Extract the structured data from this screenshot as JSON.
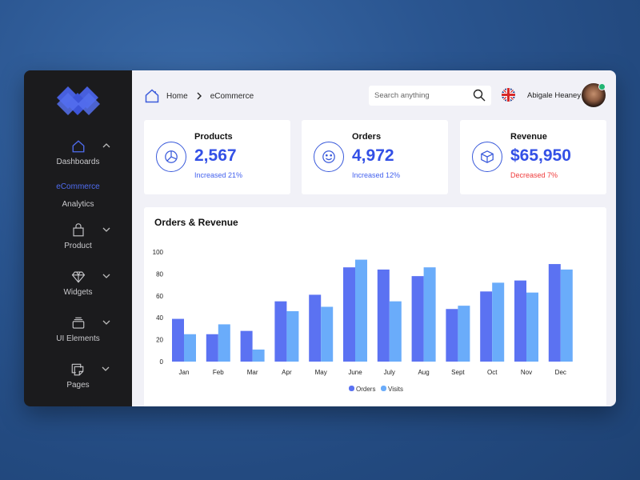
{
  "sidebar": {
    "items": [
      {
        "label": "Dashboards",
        "icon": "home-icon",
        "expanded": true,
        "children": [
          {
            "label": "eCommerce",
            "active": true
          },
          {
            "label": "Analytics",
            "active": false
          }
        ]
      },
      {
        "label": "Product",
        "icon": "shopping-bag-icon",
        "expanded": false
      },
      {
        "label": "Widgets",
        "icon": "diamond-icon",
        "expanded": false
      },
      {
        "label": "UI Elements",
        "icon": "layers-icon",
        "expanded": false
      },
      {
        "label": "Pages",
        "icon": "pages-icon",
        "expanded": false
      }
    ]
  },
  "header": {
    "breadcrumb": [
      "Home",
      "eCommerce"
    ],
    "search_placeholder": "Search anything",
    "language": "English (UK)",
    "user_name": "Abigale Heaney",
    "user_status": "online"
  },
  "stats": [
    {
      "title": "Products",
      "value": "2,567",
      "delta": "Increased 21%",
      "trend": "up",
      "icon": "pie-chart-icon"
    },
    {
      "title": "Orders",
      "value": "4,972",
      "delta": "Increased 12%",
      "trend": "up",
      "icon": "smiley-icon"
    },
    {
      "title": "Revenue",
      "value": "$65,950",
      "delta": "Decreased 7%",
      "trend": "down",
      "icon": "box-icon"
    }
  ],
  "colors": {
    "accent": "#3350e6",
    "orders": "#5b72f2",
    "visits": "#6aacfa",
    "down": "#ef3b3b",
    "sidebar": "#1b1b1d"
  },
  "chart_data": {
    "type": "bar",
    "title": "Orders & Revenue",
    "xlabel": "",
    "ylabel": "",
    "categories": [
      "Jan",
      "Feb",
      "Mar",
      "Apr",
      "May",
      "June",
      "July",
      "Aug",
      "Sept",
      "Oct",
      "Nov",
      "Dec"
    ],
    "series": [
      {
        "name": "Orders",
        "values": [
          39,
          25,
          28,
          55,
          61,
          86,
          84,
          78,
          48,
          64,
          74,
          89
        ]
      },
      {
        "name": "Visits",
        "values": [
          25,
          34,
          11,
          46,
          50,
          93,
          55,
          86,
          51,
          72,
          63,
          84
        ]
      }
    ],
    "yticks": [
      0,
      20,
      40,
      60,
      80,
      100
    ],
    "ylim": [
      0,
      100
    ],
    "grid": false,
    "legend": "bottom-center"
  }
}
